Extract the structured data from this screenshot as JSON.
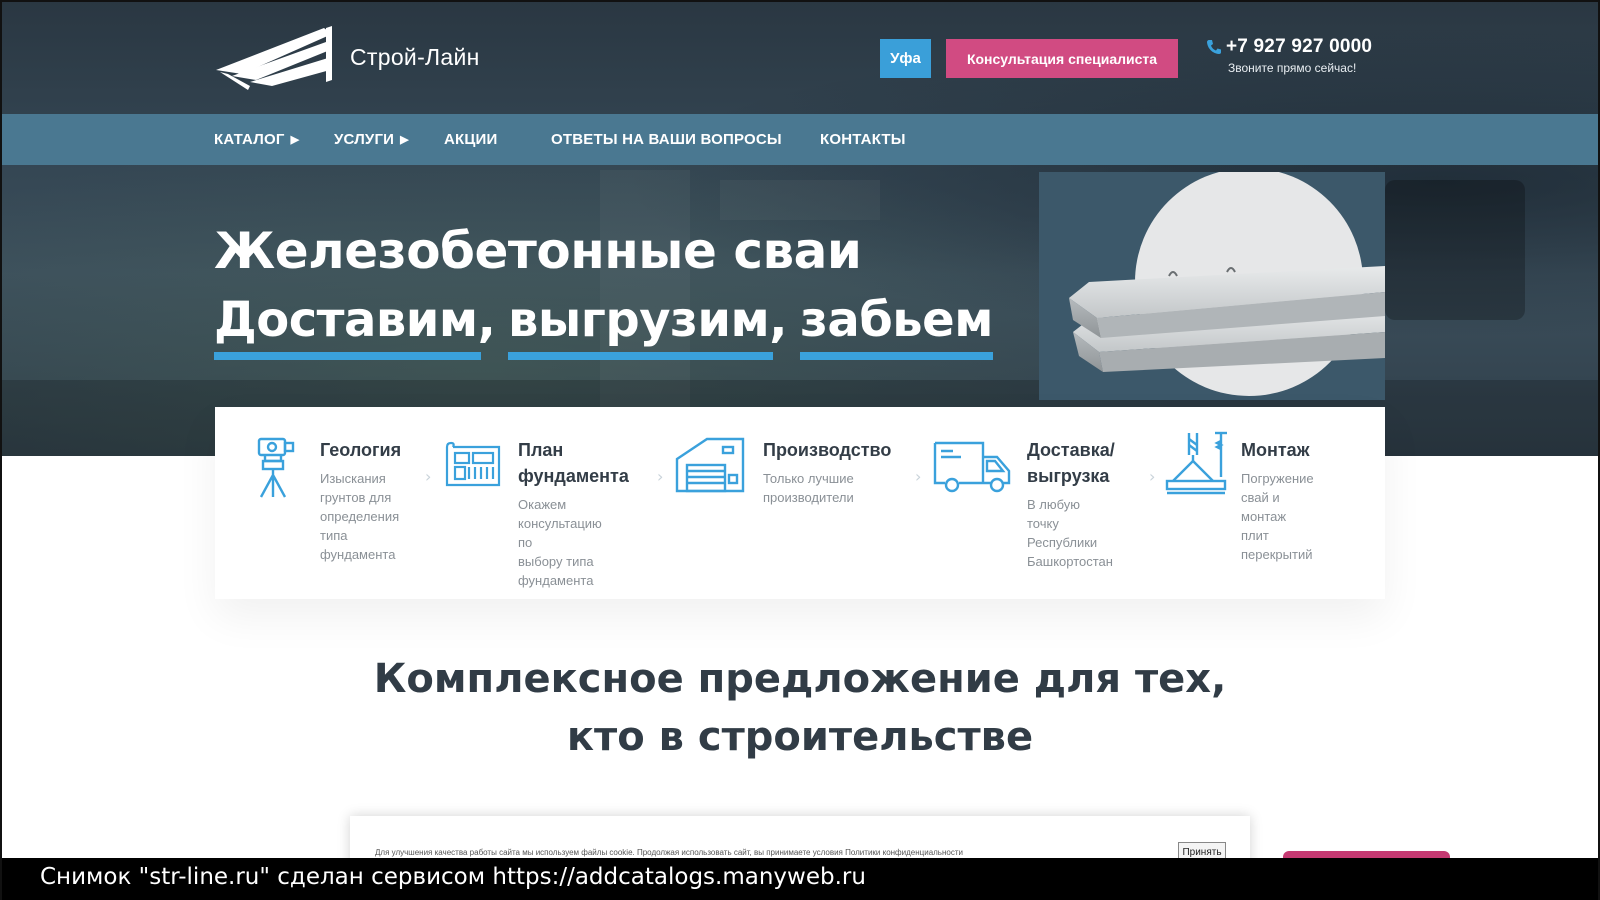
{
  "header": {
    "logo_text": "Строй-Лайн",
    "city_button": "Уфа",
    "consult_button": "Консультация специалиста",
    "phone": "+7 927 927 0000",
    "phone_sub": "Звоните прямо сейчас!"
  },
  "nav": {
    "items": [
      {
        "label": "КАТАЛОГ",
        "arrow": "▶"
      },
      {
        "label": "УСЛУГИ",
        "arrow": "▶"
      },
      {
        "label": "АКЦИИ",
        "arrow": ""
      },
      {
        "label": "ОТВЕТЫ НА ВАШИ ВОПРОСЫ",
        "arrow": ""
      },
      {
        "label": "КОНТАКТЫ",
        "arrow": ""
      }
    ]
  },
  "hero": {
    "title": "Железобетонные сваи",
    "words": [
      "Доставим,",
      "выгрузим,",
      "забьем"
    ]
  },
  "features": [
    {
      "icon": "theodolite-icon",
      "title_line1": "Геология",
      "title_line2": "",
      "desc": [
        "Изыскания",
        "грунтов для",
        "определения",
        "типа",
        "фундамента"
      ]
    },
    {
      "icon": "blueprint-icon",
      "title_line1": "План",
      "title_line2": "фундамента",
      "desc": [
        "Окажем",
        "консультацию по",
        "выбору типа",
        "фундамента"
      ]
    },
    {
      "icon": "factory-icon",
      "title_line1": "Производство",
      "title_line2": "",
      "desc": [
        "Только лучшие",
        "производители"
      ]
    },
    {
      "icon": "truck-icon",
      "title_line1": "Доставка/",
      "title_line2": "выгрузка",
      "desc": [
        "В любую точку",
        "Республики",
        "Башкортостан"
      ]
    },
    {
      "icon": "crane-icon",
      "title_line1": "Монтаж",
      "title_line2": "",
      "desc": [
        "Погружение",
        "свай и монтаж",
        "плит перекрытий"
      ]
    }
  ],
  "section": {
    "heading_line1": "Комплексное предложение для тех,",
    "heading_line2": "кто в строительстве"
  },
  "cookie": {
    "text": "Для улучшения качества работы сайта мы используем файлы cookie. Продолжая использовать сайт, вы принимаете условия Политики конфиденциальности",
    "accept": "Принять"
  },
  "caption": {
    "text": "Снимок \"str-line.ru\" сделан сервисом https://addcatalogs.manyweb.ru"
  },
  "colors": {
    "header_bg": "#344653",
    "nav_bg": "#4a7891",
    "accent_blue": "#3aa1dc",
    "accent_pink": "#d14b82",
    "heading_text": "#313c46"
  }
}
